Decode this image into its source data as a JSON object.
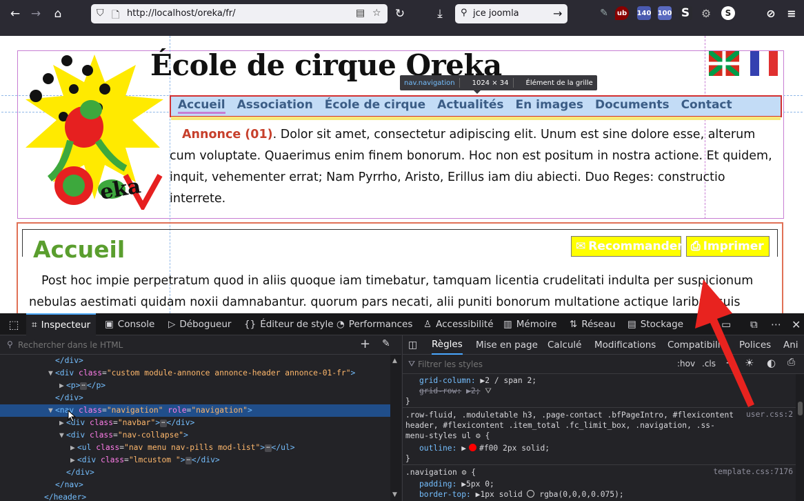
{
  "browser": {
    "url": "http://localhost/oreka/fr/",
    "search_text": "jce joomla",
    "ext_badges": [
      "140",
      "100"
    ]
  },
  "page": {
    "site_title": "École de cirque Oreka",
    "nav": [
      "Accueil",
      "Association",
      "École de cirque",
      "Actualités",
      "En images",
      "Documents",
      "Contact"
    ],
    "tooltip": {
      "tag": "nav.navigation",
      "size": "1024 × 34",
      "kind": "Élément de la grille"
    },
    "announce_label": "Annonce (01)",
    "announce_text": ". Dolor sit amet, consectetur adipiscing elit. Unum est sine dolore esse, alterum cum voluptate. Quaerimus enim finem bonorum. Hoc non est positum in nostra actione. Et quidem, inquit, vehementer errat; Nam Pyrrho, Aristo, Erillus iam diu abiecti. Duo Reges: constructio interrete.",
    "page_title": "Accueil",
    "btn_recommend": "Recommander",
    "btn_print": "Imprimer",
    "body_text": "Post hoc impie perpetratum quod in aliis quoque iam timebatur, tamquam licentia crudelitati indulta per suspicionum nebulas aestimati quidam noxii damnabantur. quorum pars necati, alii puniti bonorum multatione actique laribus suis"
  },
  "devtools": {
    "tabs": [
      "Inspecteur",
      "Console",
      "Débogueur",
      "Éditeur de style",
      "Performances",
      "Accessibilité",
      "Mémoire",
      "Réseau",
      "Stockage"
    ],
    "html_search_placeholder": "Rechercher dans le HTML",
    "rules_tabs": [
      "Règles",
      "Mise en page",
      "Calculé",
      "Modifications",
      "Compatibili",
      "Polices",
      "Ani"
    ],
    "filter_placeholder": "Filtrer les styles",
    "hov": ":hov",
    "cls": ".cls",
    "dom": [
      {
        "indent": 5,
        "twisty": "",
        "text": "</div>"
      },
      {
        "indent": 5,
        "twisty": "▼",
        "tag": "div",
        "attrs": [
          [
            "class",
            "custom module-annonce annonce-header annonce-01-fr"
          ]
        ],
        "tail": ">"
      },
      {
        "indent": 6,
        "twisty": "▶",
        "tag": "p",
        "inner": true,
        "close": "p"
      },
      {
        "indent": 5,
        "twisty": "",
        "text": "</div>"
      },
      {
        "indent": 5,
        "twisty": "▼",
        "tag": "nav",
        "attrs": [
          [
            "class",
            "navigation"
          ],
          [
            "role",
            "navigation"
          ]
        ],
        "tail": ">",
        "selected": true
      },
      {
        "indent": 6,
        "twisty": "▶",
        "tag": "div",
        "attrs": [
          [
            "class",
            "navbar"
          ]
        ],
        "inner": true,
        "close": "div"
      },
      {
        "indent": 6,
        "twisty": "▼",
        "tag": "div",
        "attrs": [
          [
            "class",
            "nav-collapse"
          ]
        ],
        "tail": ">"
      },
      {
        "indent": 7,
        "twisty": "▶",
        "tag": "ul",
        "attrs": [
          [
            "class",
            "nav menu nav-pills mod-list"
          ]
        ],
        "inner": true,
        "close": "ul"
      },
      {
        "indent": 7,
        "twisty": "▶",
        "tag": "div",
        "attrs": [
          [
            "class",
            "lmcustom "
          ]
        ],
        "inner": true,
        "close": "div"
      },
      {
        "indent": 6,
        "twisty": "",
        "text": "</div>"
      },
      {
        "indent": 5,
        "twisty": "",
        "text": "</nav>"
      },
      {
        "indent": 4,
        "twisty": "",
        "text": "</header>"
      }
    ],
    "rule1": {
      "p1": "grid-column:",
      "v1": "2 / span 2;",
      "p2": "grid-row:",
      "v2": "2;"
    },
    "rule2": {
      "selector": [
        ".row-fluid, .moduletable h3, .page-contact .bfPageIntro, #flexicontent",
        "header, #flexicontent .item_total .fc_limit_box, .navigation, .ss-",
        "menu-styles ul"
      ],
      "source": "user.css:2",
      "prop": "outline:",
      "val": "#f00 2px solid;"
    },
    "rule3": {
      "selector": ".navigation",
      "source": "template.css:7176",
      "p1": "padding:",
      "v1": "5px 0;",
      "p2": "border-top:",
      "v2": "1px solid",
      "v2b": "rgba(0,0,0,0.075);"
    }
  }
}
